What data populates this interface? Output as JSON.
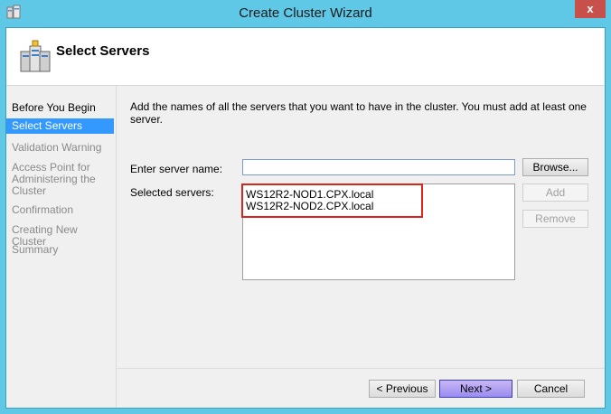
{
  "window": {
    "title": "Create Cluster Wizard",
    "close_label": "x"
  },
  "header": {
    "title": "Select Servers"
  },
  "nav": {
    "items": [
      {
        "label": "Before You Begin"
      },
      {
        "label": "Select Servers"
      },
      {
        "label": "Validation Warning"
      },
      {
        "label": "Access Point for\nAdministering the\nCluster"
      },
      {
        "label": "Confirmation"
      },
      {
        "label": "Creating New Cluster"
      },
      {
        "label": "Summary"
      }
    ]
  },
  "main": {
    "intro": "Add the names of all the servers that you want to have in the cluster. You must add at least one server.",
    "server_name_label": "Enter server name:",
    "server_name_value": "",
    "selected_label": "Selected servers:",
    "selected_servers": [
      "WS12R2-NOD1.CPX.local",
      "WS12R2-NOD2.CPX.local"
    ],
    "browse_label": "Browse...",
    "add_label": "Add",
    "remove_label": "Remove"
  },
  "footer": {
    "previous_label": "< Previous",
    "next_label": "Next >",
    "cancel_label": "Cancel"
  },
  "colors": {
    "accent": "#3399ff",
    "frame": "#5fc8e6",
    "highlight_box": "#d9261c"
  }
}
